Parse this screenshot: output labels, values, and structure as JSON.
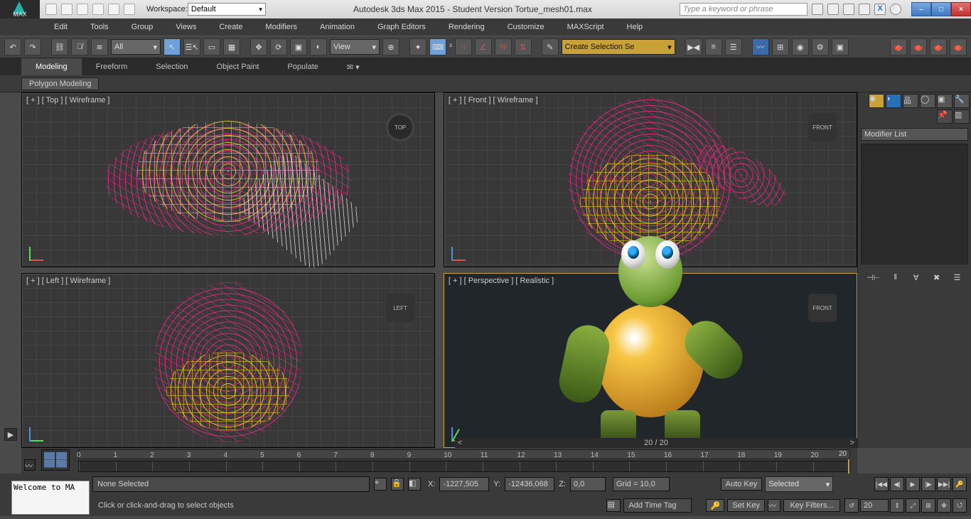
{
  "title": "Autodesk 3ds Max 2015 - Student Version   Tortue_mesh01.max",
  "logo_text": "MAX",
  "workspace_label": "Workspace:",
  "workspace_value": "Default",
  "search_placeholder": "Type a keyword or phrase",
  "menu": [
    "Edit",
    "Tools",
    "Group",
    "Views",
    "Create",
    "Modifiers",
    "Animation",
    "Graph Editors",
    "Rendering",
    "Customize",
    "MAXScript",
    "Help"
  ],
  "filter_value": "All",
  "view_label": "View",
  "coord_prefix": "³",
  "named_set_placeholder": "Create Selection Se",
  "ribbon_tabs": [
    "Modeling",
    "Freeform",
    "Selection",
    "Object Paint",
    "Populate"
  ],
  "subribbon": "Polygon Modeling",
  "viewports": {
    "top": "[ + ] [ Top ] [ Wireframe ]",
    "front": "[ + ] [ Front ] [ Wireframe ]",
    "left": "[ + ] [ Left ] [ Wireframe ]",
    "persp": "[ + ] [ Perspective ] [ Realistic ]",
    "cube_top": "TOP",
    "cube_front": "FRONT",
    "cube_left": "LEFT",
    "cube_pfront": "FRONT"
  },
  "hscroll_frames": "20 / 20",
  "modifier_list": "Modifier List",
  "timeline_frames": [
    "0",
    "1",
    "2",
    "3",
    "4",
    "5",
    "6",
    "7",
    "8",
    "9",
    "10",
    "11",
    "12",
    "13",
    "14",
    "15",
    "16",
    "17",
    "18",
    "19",
    "20"
  ],
  "track_slider_end": "20",
  "status": {
    "selection": "None Selected",
    "prompt": "Click or click-and-drag to select objects",
    "x_label": "X:",
    "x_val": "-1227,505",
    "y_label": "Y:",
    "y_val": "-12436,068",
    "z_label": "Z:",
    "z_val": "0,0",
    "grid": "Grid = 10,0",
    "auto_key": "Auto Key",
    "set_key": "Set Key",
    "filters_combo": "Selected",
    "key_filters": "Key Filters...",
    "add_tag": "Add Time Tag",
    "cur_frame": "20",
    "welcome": "Welcome to MA"
  }
}
